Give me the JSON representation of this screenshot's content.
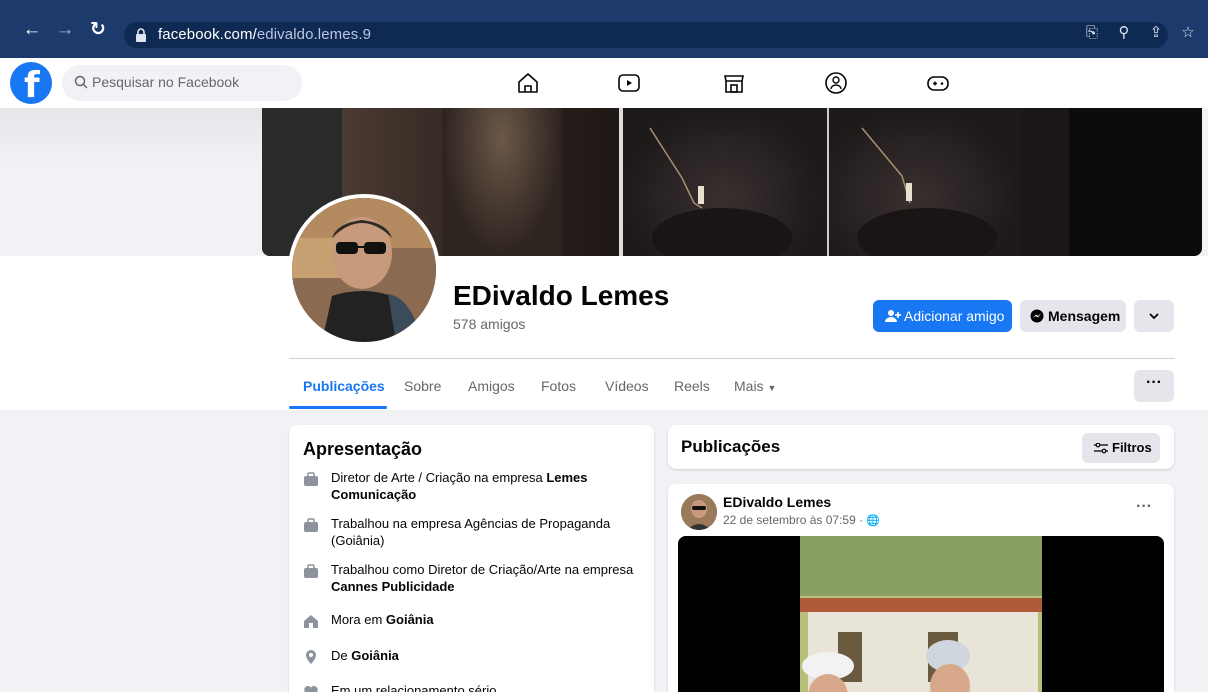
{
  "browser": {
    "url_host": "facebook.com/",
    "url_path": "edivaldo.lemes.9"
  },
  "fb": {
    "search_placeholder": "Pesquisar no Facebook"
  },
  "profile": {
    "name": "EDivaldo Lemes",
    "friends": "578 amigos",
    "add_friend_label": "Adicionar amigo",
    "message_label": "Mensagem"
  },
  "tabs": [
    {
      "label": "Publicações"
    },
    {
      "label": "Sobre"
    },
    {
      "label": "Amigos"
    },
    {
      "label": "Fotos"
    },
    {
      "label": "Vídeos"
    },
    {
      "label": "Reels"
    },
    {
      "label": "Mais"
    }
  ],
  "intro": {
    "title": "Apresentação",
    "items": [
      {
        "icon": "briefcase-icon",
        "text": "Diretor de Arte / Criação na empresa ",
        "bold": "Lemes Comunicação"
      },
      {
        "icon": "briefcase-icon",
        "text": "Trabalhou na empresa Agências de Propaganda (Goiânia)",
        "bold": ""
      },
      {
        "icon": "briefcase-icon",
        "text": "Trabalhou como Diretor de Criação/Arte na empresa ",
        "bold": "Cannes Publicidade"
      },
      {
        "icon": "home-icon",
        "text": "Mora em ",
        "bold": "Goiânia"
      },
      {
        "icon": "location-pin-icon",
        "text": "De ",
        "bold": "Goiânia"
      },
      {
        "icon": "heart-icon",
        "text": "Em um relacionamento sério",
        "bold": ""
      }
    ]
  },
  "publications": {
    "title": "Publicações",
    "filter_label": "Filtros"
  },
  "post": {
    "author": "EDivaldo Lemes",
    "time": "22 de setembro às 07:59 · "
  },
  "colors": {
    "brand": "#1877f2",
    "browser_bar": "#1c3a6b"
  }
}
